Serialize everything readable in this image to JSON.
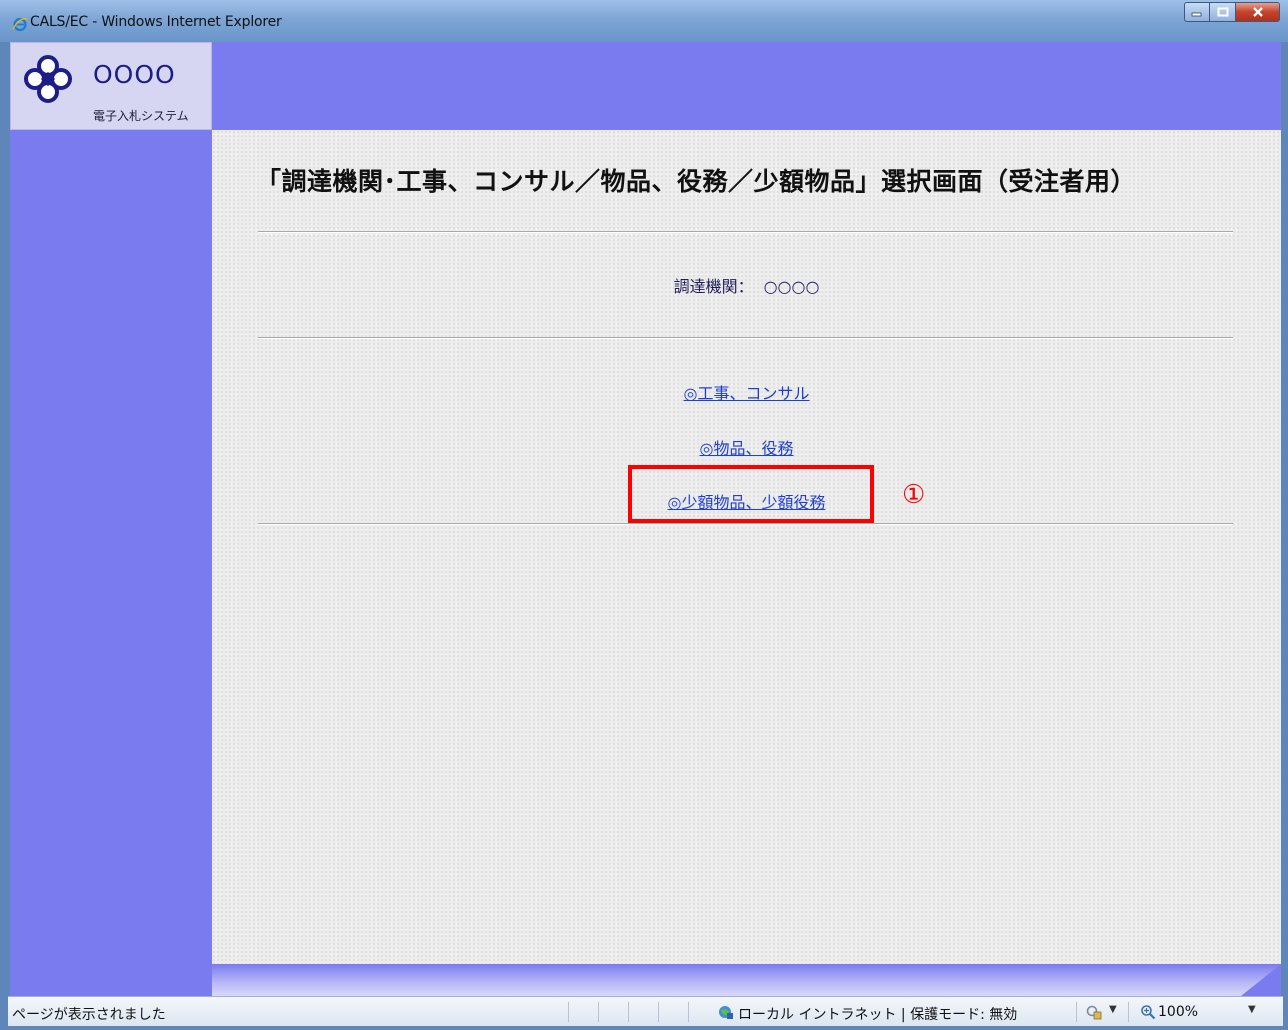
{
  "window": {
    "title": "CALS/EC - Windows Internet Explorer"
  },
  "header": {
    "org_name": "OOOO",
    "system_name": "電子入札システム"
  },
  "main": {
    "page_title": "「調達機関･工事、コンサル／物品、役務／少額物品」選択画面（受注者用）",
    "org_label": "調達機関：",
    "org_value": "○○○○",
    "links": [
      {
        "label": "◎工事、コンサル"
      },
      {
        "label": "◎物品、役務"
      },
      {
        "label": "◎少額物品、少額役務"
      }
    ],
    "annotation_marker": "①"
  },
  "statusbar": {
    "status_text": "ページが表示されました",
    "zone_text": "ローカル イントラネット | 保護モード: 無効",
    "zoom_text": "100%"
  },
  "colors": {
    "sidebar": "#7b7bf0",
    "link": "#1f3fcf",
    "highlight": "#ff0000"
  },
  "icons": [
    "ie-icon",
    "minimize-icon",
    "maximize-icon",
    "close-icon",
    "logo-mark-icon",
    "intranet-zone-icon",
    "protected-mode-icon",
    "zoom-icon",
    "dropdown-arrow-icon"
  ]
}
